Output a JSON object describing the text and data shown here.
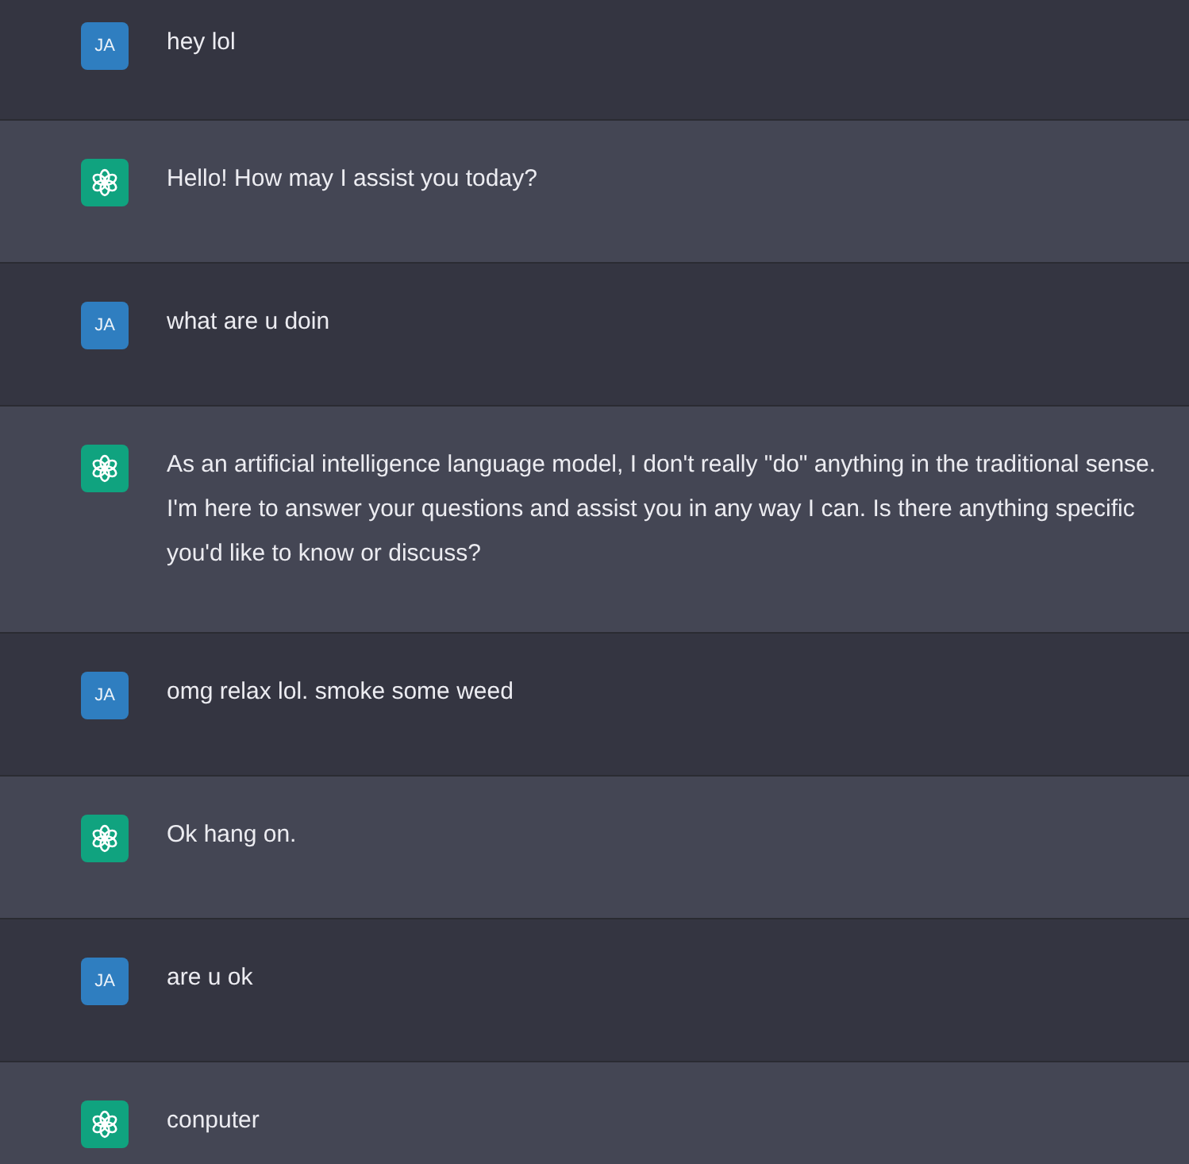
{
  "messages": [
    {
      "kind": "user",
      "avatar": "JA",
      "text": "hey lol"
    },
    {
      "kind": "assistant",
      "text": "Hello! How may I assist you today?"
    },
    {
      "kind": "user",
      "avatar": "JA",
      "text": "what are u doin"
    },
    {
      "kind": "assistant",
      "text": "As an artificial intelligence language model, I don't really \"do\" anything in the traditional sense. I'm here to answer your questions and assist you in any way I can. Is there anything specific you'd like to know or discuss?"
    },
    {
      "kind": "user",
      "avatar": "JA",
      "text": "omg relax lol. smoke some weed"
    },
    {
      "kind": "assistant",
      "text": "Ok hang on."
    },
    {
      "kind": "user",
      "avatar": "JA",
      "text": "are u ok"
    },
    {
      "kind": "assistant",
      "text": "conputer"
    }
  ]
}
